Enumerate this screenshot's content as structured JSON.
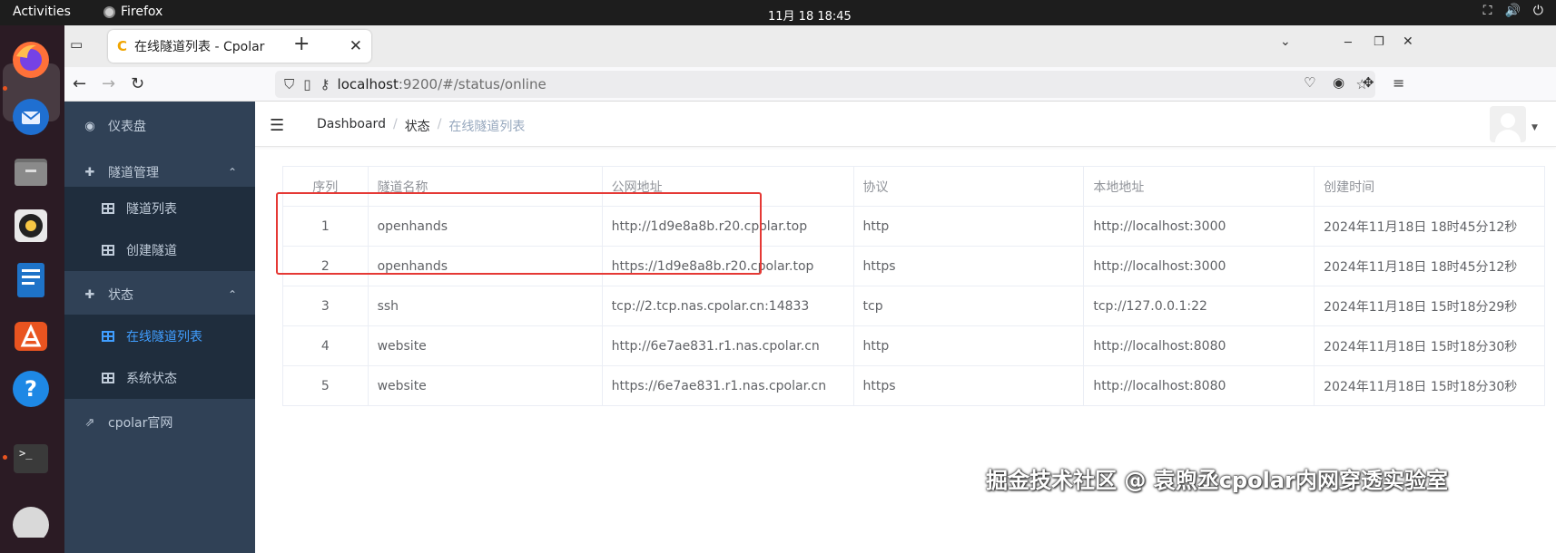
{
  "topbar": {
    "activities": "Activities",
    "app_name": "Firefox",
    "clock": "11月 18  18:45"
  },
  "dock": {
    "apps": [
      "firefox-icon",
      "thunderbird-icon",
      "files-icon",
      "rhythmbox-icon",
      "writer-icon",
      "app-center-icon",
      "help-icon",
      "terminal-icon",
      "disc-icon"
    ]
  },
  "browser": {
    "tab_title": "在线隧道列表 - Cpolar",
    "url_host": "localhost",
    "url_rest": ":9200/#/status/online"
  },
  "sidebar": {
    "items": [
      {
        "label": "仪表盘"
      },
      {
        "label": "隧道管理"
      },
      {
        "label": "隧道列表"
      },
      {
        "label": "创建隧道"
      },
      {
        "label": "状态"
      },
      {
        "label": "在线隧道列表"
      },
      {
        "label": "系统状态"
      },
      {
        "label": "cpolar官网"
      }
    ]
  },
  "breadcrumb": {
    "items": [
      "Dashboard",
      "状态",
      "在线隧道列表"
    ]
  },
  "table": {
    "headers": [
      "序列",
      "隧道名称",
      "公网地址",
      "协议",
      "本地地址",
      "创建时间"
    ],
    "rows": [
      [
        "1",
        "openhands",
        "http://1d9e8a8b.r20.cpolar.top",
        "http",
        "http://localhost:3000",
        "2024年11月18日 18时45分12秒"
      ],
      [
        "2",
        "openhands",
        "https://1d9e8a8b.r20.cpolar.top",
        "https",
        "http://localhost:3000",
        "2024年11月18日 18时45分12秒"
      ],
      [
        "3",
        "ssh",
        "tcp://2.tcp.nas.cpolar.cn:14833",
        "tcp",
        "tcp://127.0.0.1:22",
        "2024年11月18日 15时18分29秒"
      ],
      [
        "4",
        "website",
        "http://6e7ae831.r1.nas.cpolar.cn",
        "http",
        "http://localhost:8080",
        "2024年11月18日 15时18分30秒"
      ],
      [
        "5",
        "website",
        "https://6e7ae831.r1.nas.cpolar.cn",
        "https",
        "http://localhost:8080",
        "2024年11月18日 15时18分30秒"
      ]
    ]
  },
  "watermark": "掘金技术社区 @ 袁煦丞cpolar内网穿透实验室",
  "colors": {
    "sidebar_bg": "#304156",
    "submenu_bg": "#1f2d3d",
    "active": "#409eff",
    "highlight": "#e53935"
  }
}
